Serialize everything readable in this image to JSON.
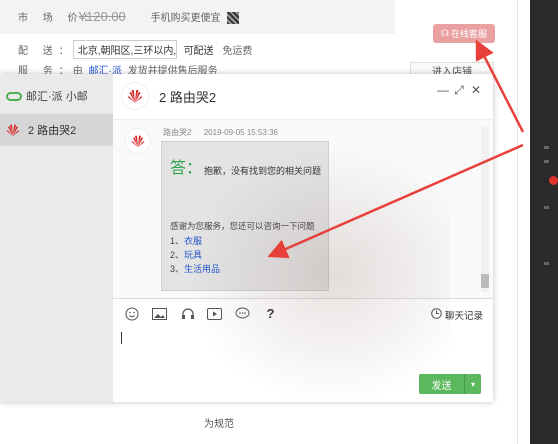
{
  "page": {
    "market_price_label": "市 场 价：",
    "market_price": "¥120.00",
    "mobile_buy": "手机购买更便宜",
    "delivery_label": "配 送：",
    "delivery_address": "北京,朝阳区,三环以内,",
    "delivery_status": "可配送",
    "shipping": "免运费",
    "service_label": "服 务：",
    "service_by": "由",
    "service_shop": "邮汇·派",
    "service_text": "发货并提供售后服务",
    "online_service": "在线客服",
    "enter_shop": "进入店铺",
    "bottom_text": "为规范"
  },
  "chat": {
    "brand": "邮汇·派 小邮",
    "contact_name": "2 路由哭2",
    "header_title": "2 路由哭2",
    "window_controls": {
      "minimize": "—",
      "maximize": "⤢",
      "close": "✕"
    },
    "message": {
      "sender": "路由哭2",
      "time": "2019-09-05 15:53:36",
      "answer_label": "答：",
      "answer_text": "抱歉，没有找到您的相关问题",
      "thanks": "感谢为您服务，您还可以咨询一下问题",
      "options": [
        {
          "num": "1、",
          "label": "衣服"
        },
        {
          "num": "2、",
          "label": "玩具"
        },
        {
          "num": "3、",
          "label": "生活用品"
        }
      ]
    },
    "toolbar": {
      "icons": [
        "emoji-icon",
        "image-icon",
        "headset-icon",
        "video-icon",
        "chat-bubble-icon",
        "help-icon"
      ],
      "help_glyph": "?",
      "history_label": "聊天记录"
    },
    "send_label": "发送",
    "send_dropdown": "▾"
  },
  "colors": {
    "accent_green": "#5cb85c",
    "answer_green": "#2aa44a",
    "link_blue": "#2255cc",
    "arrow_red": "#e8413b",
    "service_button": "#e9a0a0"
  }
}
